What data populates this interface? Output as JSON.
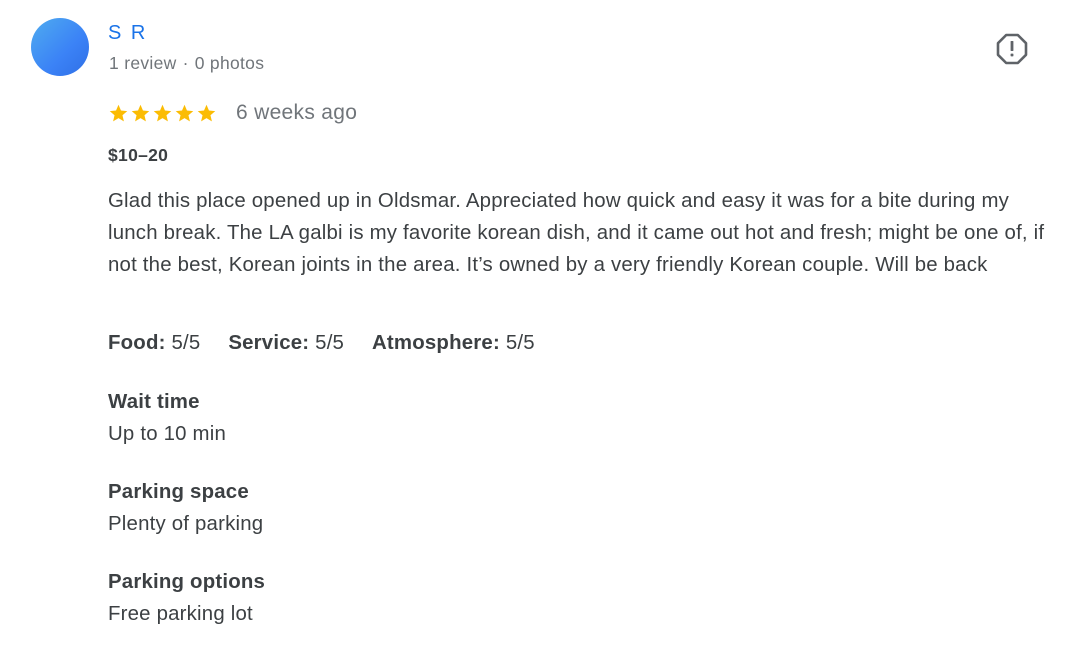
{
  "author": {
    "name": "S R",
    "review_count": "1 review",
    "separator": "·",
    "photo_count": "0 photos",
    "avatar_color": "#3b82f6"
  },
  "flag_icon": "report-flag-icon",
  "rating": {
    "stars": 5,
    "max_stars": 5,
    "star_color": "#fbbc04",
    "date": "6 weeks ago"
  },
  "price": "$10–20",
  "text": "Glad this place opened up in Oldsmar. Appreciated how quick and easy it was for a bite during my lunch break. The LA galbi is my favorite korean dish, and it came out hot and fresh; might be one of, if not the best, Korean joints in the area. It’s owned by a very friendly Korean couple. Will be back",
  "sub_ratings": [
    {
      "label": "Food:",
      "value": "5/5"
    },
    {
      "label": "Service:",
      "value": "5/5"
    },
    {
      "label": "Atmosphere:",
      "value": "5/5"
    }
  ],
  "attributes": [
    {
      "label": "Wait time",
      "value": "Up to 10 min"
    },
    {
      "label": "Parking space",
      "value": "Plenty of parking"
    },
    {
      "label": "Parking options",
      "value": "Free parking lot"
    }
  ]
}
